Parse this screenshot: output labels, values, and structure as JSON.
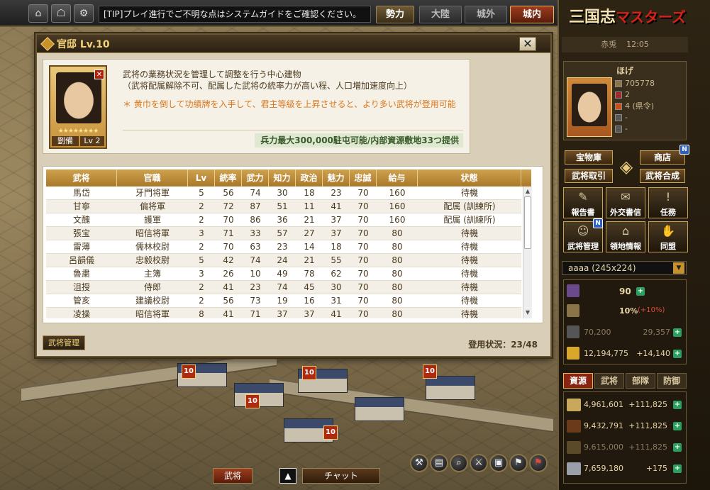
{
  "topbar": {
    "tip_text": "[TIP]プレイ進行でご不明な点はシステムガイドをご確認ください。",
    "power_button": "勢力",
    "continent_button": "大陸",
    "outside_button": "城外",
    "inside_button": "城内"
  },
  "dialog": {
    "title": "官邸 Lv.10",
    "close_label": "✕",
    "portrait": {
      "name": "劉備",
      "level": "Lv 2",
      "stars": "★★★★★★★★"
    },
    "desc_line1": "武将の業務状況を管理して調整を行う中心建物",
    "desc_line2": "（武将配属解除不可、配属した武将の統率力が高い程、人口増加速度向上）",
    "desc_note": "＊ 黄巾を倒して功績牌を入手して、君主等級を上昇させると、より多い武将が登用可能",
    "capacity_text": "兵力最大300,000駐屯可能/内部資源敷地33つ提供",
    "table": {
      "headers": [
        "武将",
        "官職",
        "Lv",
        "統率",
        "武力",
        "知力",
        "政治",
        "魅力",
        "忠誠",
        "給与",
        "状態"
      ],
      "rows": [
        [
          "馬岱",
          "牙門将軍",
          "5",
          "56",
          "74",
          "30",
          "18",
          "23",
          "70",
          "160",
          "待機"
        ],
        [
          "甘寧",
          "偏将軍",
          "2",
          "72",
          "87",
          "51",
          "11",
          "41",
          "70",
          "160",
          "配属 (訓練所)"
        ],
        [
          "文醜",
          "護軍",
          "2",
          "70",
          "86",
          "36",
          "21",
          "37",
          "70",
          "160",
          "配属 (訓練所)"
        ],
        [
          "張宝",
          "昭信将軍",
          "3",
          "71",
          "33",
          "57",
          "27",
          "37",
          "70",
          "80",
          "待機"
        ],
        [
          "雷薄",
          "儒林校尉",
          "2",
          "70",
          "63",
          "23",
          "14",
          "18",
          "70",
          "80",
          "待機"
        ],
        [
          "呂韻儀",
          "忠毅校尉",
          "5",
          "42",
          "74",
          "24",
          "21",
          "55",
          "70",
          "80",
          "待機"
        ],
        [
          "魯粛",
          "主簿",
          "3",
          "26",
          "10",
          "49",
          "78",
          "62",
          "70",
          "80",
          "待機"
        ],
        [
          "沮授",
          "侍郎",
          "2",
          "41",
          "23",
          "74",
          "45",
          "30",
          "70",
          "80",
          "待機"
        ],
        [
          "管亥",
          "建議校尉",
          "2",
          "56",
          "73",
          "19",
          "16",
          "31",
          "70",
          "80",
          "待機"
        ],
        [
          "凌操",
          "昭信将軍",
          "8",
          "41",
          "71",
          "37",
          "37",
          "41",
          "70",
          "80",
          "待機"
        ]
      ]
    },
    "manage_button": "武将管理",
    "recruit_status": "登用状況：23/48"
  },
  "bottom": {
    "general_tab": "武将",
    "chat_tab": "チャット"
  },
  "right": {
    "logo_main": "三国志",
    "logo_accent": "マスターズ",
    "server": "赤兎",
    "time": "12:05",
    "player_name": "ほげ",
    "stat_gold": "705778",
    "stat_2": "2",
    "stat_rank": "4 (県令)",
    "stat_4": "-",
    "stat_5": "-",
    "menu": {
      "treasury": "宝物庫",
      "shop": "商店",
      "general_trade": "武将取引",
      "general_merge": "武将合成",
      "report": "報告書",
      "diplomacy": "外交書信",
      "mission": "任務",
      "general_manage": "武将管理",
      "territory": "領地情報",
      "alliance": "同盟"
    },
    "city": "aaaa (245x224)",
    "troops": "90",
    "tax": "10%",
    "tax_bonus": "(+10%)",
    "population": "70,200",
    "population_max": "29,357",
    "gold": "12,194,775",
    "gold_inc": "+14,140",
    "res_tabs": [
      "資源",
      "武将",
      "部隊",
      "防御"
    ],
    "resources": [
      {
        "value": "4,961,601",
        "inc": "+111,825"
      },
      {
        "value": "9,432,791",
        "inc": "+111,825"
      },
      {
        "value": "9,615,000",
        "inc": "+111,825"
      },
      {
        "value": "7,659,180",
        "inc": "+175"
      }
    ]
  },
  "colors": {
    "accent_gold": "#c8922a",
    "header_brown": "#a9782a",
    "note_orange": "#d9781e",
    "active_red": "#8a2412"
  }
}
